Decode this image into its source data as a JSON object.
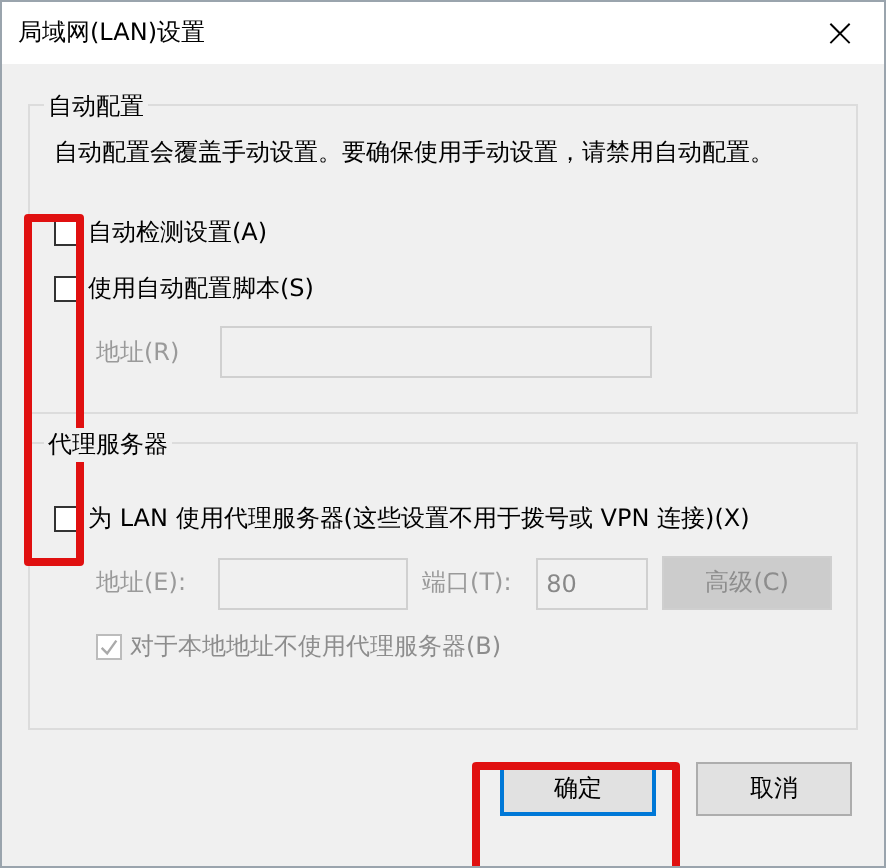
{
  "window": {
    "title": "局域网(LAN)设置",
    "close": "×"
  },
  "auto_config": {
    "legend": "自动配置",
    "description": "自动配置会覆盖手动设置。要确保使用手动设置，请禁用自动配置。",
    "options": [
      {
        "label": "自动检测设置(A)",
        "checked": false
      },
      {
        "label": "使用自动配置脚本(S)",
        "checked": false
      }
    ],
    "address": {
      "label": "地址(R)",
      "disabled": true
    }
  },
  "proxy": {
    "legend": "代理服务器",
    "use_proxy": {
      "label": "为 LAN 使用代理服务器(这些设置不用于拨号或 VPN 连接)(X)",
      "checked": false
    },
    "address": {
      "label": "地址(E):",
      "disabled": true
    },
    "port": {
      "label": "端口(T):",
      "value": "80",
      "disabled": true
    },
    "advanced": {
      "label": "高级(C)",
      "disabled": true
    },
    "bypass_local": {
      "label": "对于本地地址不使用代理服务器(B)",
      "checked": true,
      "disabled": true
    }
  },
  "buttons": [
    {
      "label": "确定",
      "default": true
    },
    {
      "label": "取消",
      "default": false
    }
  ],
  "highlights": {
    "checkbox_column": true,
    "ok_button": true
  }
}
